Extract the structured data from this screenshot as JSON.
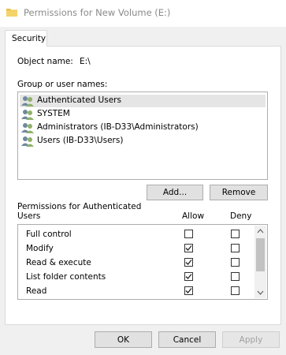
{
  "window": {
    "title": "Permissions for New Volume (E:)"
  },
  "tabs": [
    {
      "label": "Security"
    }
  ],
  "object": {
    "label": "Object name:",
    "value": "E:\\"
  },
  "groups": {
    "label": "Group or user names:",
    "items": [
      {
        "label": "Authenticated Users",
        "selected": true
      },
      {
        "label": "SYSTEM",
        "selected": false
      },
      {
        "label": "Administrators (IB-D33\\Administrators)",
        "selected": false
      },
      {
        "label": "Users (IB-D33\\Users)",
        "selected": false
      }
    ]
  },
  "buttons": {
    "add": "Add...",
    "remove": "Remove",
    "ok": "OK",
    "cancel": "Cancel",
    "apply": "Apply"
  },
  "permissions": {
    "label_line1": "Permissions for Authenticated",
    "label_line2": "Users",
    "allow_header": "Allow",
    "deny_header": "Deny",
    "rows": [
      {
        "name": "Full control",
        "allow": false,
        "deny": false
      },
      {
        "name": "Modify",
        "allow": true,
        "deny": false
      },
      {
        "name": "Read & execute",
        "allow": true,
        "deny": false
      },
      {
        "name": "List folder contents",
        "allow": true,
        "deny": false
      },
      {
        "name": "Read",
        "allow": true,
        "deny": false
      },
      {
        "name": "",
        "allow": true,
        "deny": false
      }
    ]
  },
  "colors": {
    "selection": "#e5e5e5",
    "border": "#adadad",
    "button": "#e1e1e1",
    "folder": "#e8c04a"
  }
}
